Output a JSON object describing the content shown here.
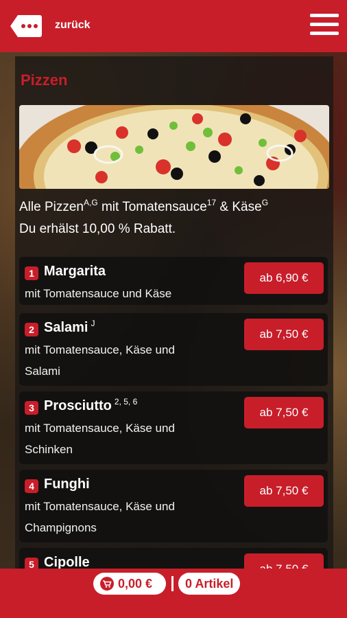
{
  "colors": {
    "brand": "#c81e2a",
    "panel": "#1c1816",
    "text": "#ffffff"
  },
  "header": {
    "back_icon": "more-dots-back-icon",
    "back_label": "zurück",
    "menu_icon": "hamburger-menu-icon"
  },
  "section": {
    "title": "Pizzen",
    "intro_parts": {
      "p1": "Alle Pizzen",
      "s1": "A,G",
      "p2": " mit Tomatensauce",
      "s2": "17",
      "p3": " & Käse",
      "s3": "G"
    },
    "discount": "Du erhälst 10,00 % Rabatt."
  },
  "items": [
    {
      "num": "1",
      "name": "Margarita",
      "sup": "",
      "desc_l1": "mit Tomatensauce und Käse",
      "desc_l2": "",
      "price": "ab 6,90 €"
    },
    {
      "num": "2",
      "name": "Salami",
      "sup": "J",
      "desc_l1": "mit Tomatensauce, Käse und",
      "desc_l2": "Salami",
      "price": "ab 7,50 €"
    },
    {
      "num": "3",
      "name": "Prosciutto",
      "sup": "2, 5, 6",
      "desc_l1": "mit Tomatensauce, Käse und",
      "desc_l2": "Schinken",
      "price": "ab 7,50 €"
    },
    {
      "num": "4",
      "name": "Funghi",
      "sup": "",
      "desc_l1": "mit Tomatensauce, Käse und",
      "desc_l2": "Champignons",
      "price": "ab 7,50 €"
    },
    {
      "num": "5",
      "name": "Cipolle",
      "sup": "",
      "desc_l1": "",
      "desc_l2": "",
      "price": "ab 7,50 €"
    }
  ],
  "footer": {
    "cart_icon": "shopping-cart-icon",
    "cart_total": "0,00 €",
    "articles": "0 Artikel"
  }
}
